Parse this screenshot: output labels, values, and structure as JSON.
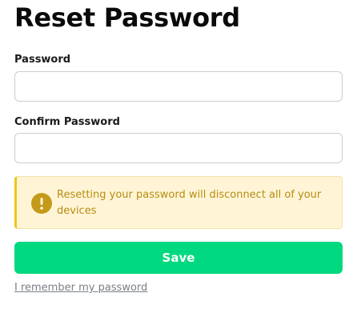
{
  "page": {
    "title": "Reset Password"
  },
  "form": {
    "password_label": "Password",
    "password_value": "",
    "confirm_label": "Confirm Password",
    "confirm_value": ""
  },
  "alert": {
    "icon": "warning-circle-icon",
    "message": "Resetting your password will disconnect all of your devices",
    "colors": {
      "background": "#fff5d6",
      "accent": "#f0c419",
      "text": "#b88c12",
      "icon": "#c49a1a"
    }
  },
  "actions": {
    "save_label": "Save",
    "save_color": "#00d97f",
    "remember_link": "I remember my password"
  }
}
